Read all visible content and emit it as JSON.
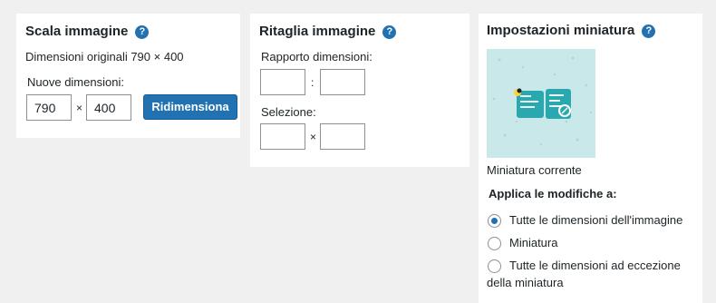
{
  "scale": {
    "title": "Scala immagine",
    "help_icon": "question-circle-icon",
    "original_text": "Dimensioni originali 790 × 400",
    "new_label": "Nuove dimensioni:",
    "width_value": "790",
    "separator": "×",
    "height_value": "400",
    "button_label": "Ridimensiona"
  },
  "crop": {
    "title": "Ritaglia immagine",
    "help_icon": "question-circle-icon",
    "ratio_label": "Rapporto dimensioni:",
    "ratio_separator": ":",
    "selection_label": "Selezione:",
    "selection_separator": "×"
  },
  "thumbnail": {
    "title": "Impostazioni miniatura",
    "help_icon": "question-circle-icon",
    "caption": "Miniatura corrente",
    "apply_label": "Applica le modifiche a:",
    "options": [
      {
        "label": "Tutte le dimensioni dell'immagine",
        "checked": true
      },
      {
        "label": "Miniatura",
        "checked": false
      },
      {
        "label": "Tutte le dimensioni ad eccezione",
        "label_cont": "della miniatura",
        "checked": false
      }
    ]
  },
  "colors": {
    "accent": "#2271b1",
    "background": "#f0f0f1",
    "panel": "#ffffff",
    "thumb_background": "#c8e8ea",
    "thumb_icon": "#2aa8b0"
  }
}
